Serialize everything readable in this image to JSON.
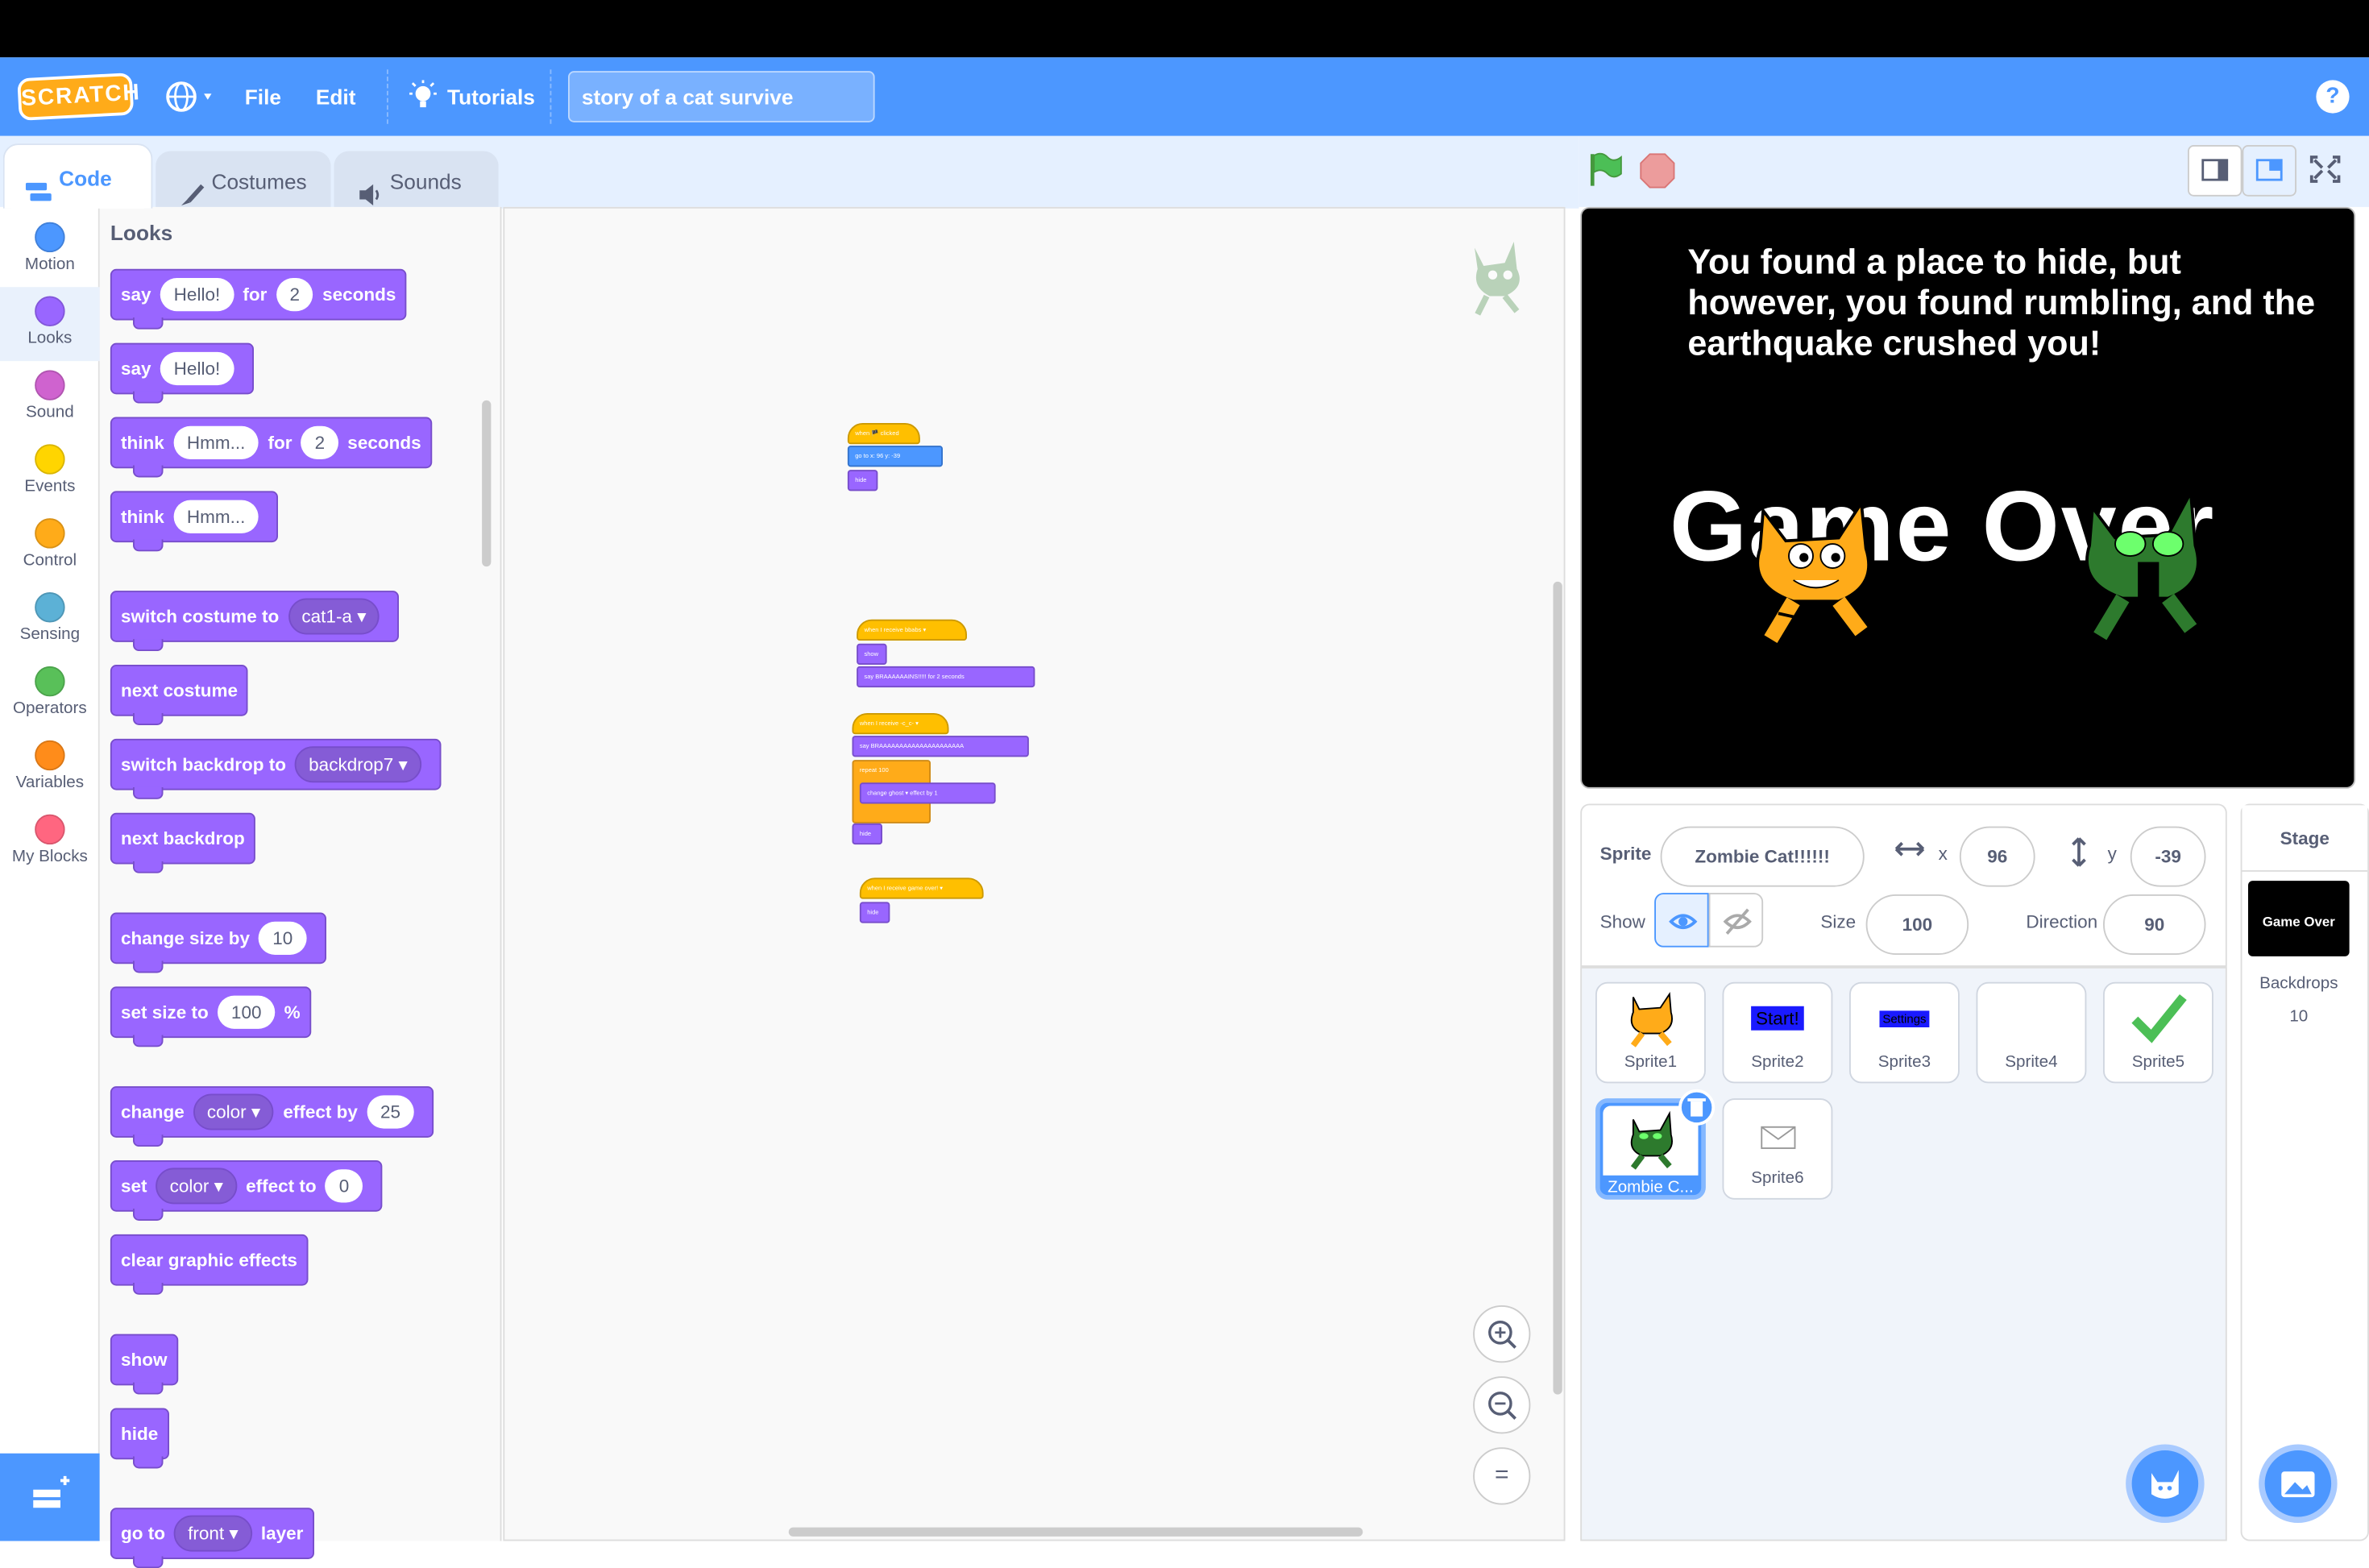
{
  "menu": {
    "file": "File",
    "edit": "Edit",
    "tutorials": "Tutorials",
    "logo": "SCRATCH",
    "project_title": "story of a cat survive",
    "help": "?"
  },
  "tabs": {
    "code": "Code",
    "costumes": "Costumes",
    "sounds": "Sounds"
  },
  "categories": [
    {
      "label": "Motion",
      "color": "#4c97ff"
    },
    {
      "label": "Looks",
      "color": "#9966ff"
    },
    {
      "label": "Sound",
      "color": "#cf63cf"
    },
    {
      "label": "Events",
      "color": "#ffd500"
    },
    {
      "label": "Control",
      "color": "#ffab19"
    },
    {
      "label": "Sensing",
      "color": "#5cb1d6"
    },
    {
      "label": "Operators",
      "color": "#59c059"
    },
    {
      "label": "Variables",
      "color": "#ff8c1a"
    },
    {
      "label": "My Blocks",
      "color": "#ff6680"
    }
  ],
  "palette": {
    "title": "Looks",
    "say_for": {
      "a": "say",
      "b": "Hello!",
      "c": "for",
      "d": "2",
      "e": "seconds"
    },
    "say": {
      "a": "say",
      "b": "Hello!"
    },
    "think_for": {
      "a": "think",
      "b": "Hmm...",
      "c": "for",
      "d": "2",
      "e": "seconds"
    },
    "think": {
      "a": "think",
      "b": "Hmm..."
    },
    "switch_costume": {
      "a": "switch costume to",
      "b": "cat1-a"
    },
    "next_costume": "next costume",
    "switch_backdrop": {
      "a": "switch backdrop to",
      "b": "backdrop7"
    },
    "next_backdrop": "next backdrop",
    "change_size": {
      "a": "change size by",
      "b": "10"
    },
    "set_size": {
      "a": "set size to",
      "b": "100",
      "c": "%"
    },
    "change_effect": {
      "a": "change",
      "b": "color",
      "c": "effect by",
      "d": "25"
    },
    "set_effect": {
      "a": "set",
      "b": "color",
      "c": "effect to",
      "d": "0"
    },
    "clear_effects": "clear graphic effects",
    "show": "show",
    "hide": "hide",
    "go_to_layer": {
      "a": "go to",
      "b": "front",
      "c": "layer"
    }
  },
  "scripts": {
    "s1": {
      "hat": "when 🏴 clicked",
      "goto": "go to x: 96 y: -39",
      "hide": "hide"
    },
    "s2": {
      "hat": "when I receive bbabs ▾",
      "show": "show",
      "say": "say BRAAAAAAINS!!!!! for 2 seconds"
    },
    "s3": {
      "hat": "when I receive -c_c- ▾",
      "say": "say BRAAAAAAAAAAAAAAAAAAAAA",
      "repeat": "repeat 100",
      "change": "change ghost ▾ effect by 1",
      "hide": "hide"
    },
    "s4": {
      "hat": "when I receive game over! ▾",
      "hide": "hide"
    }
  },
  "zoom": {
    "in": "+",
    "out": "−",
    "reset": "="
  },
  "stage": {
    "message": "You found a place to hide, but however, you found rumbling, and the earthquake crushed you!",
    "game_over": "Game Over"
  },
  "sprite_info": {
    "sprite_label": "Sprite",
    "sprite_name": "Zombie Cat!!!!!!",
    "x_label": "x",
    "x": "96",
    "y_label": "y",
    "y": "-39",
    "show_label": "Show",
    "size_label": "Size",
    "size": "100",
    "direction_label": "Direction",
    "direction": "90"
  },
  "sprites": [
    {
      "name": "Sprite1"
    },
    {
      "name": "Sprite2",
      "thumb": "Start!"
    },
    {
      "name": "Sprite3",
      "thumb": "Settings"
    },
    {
      "name": "Sprite4"
    },
    {
      "name": "Sprite5"
    },
    {
      "name": "Zombie C..."
    },
    {
      "name": "Sprite6"
    }
  ],
  "stage_pane": {
    "title": "Stage",
    "thumb_text": "Game Over",
    "backdrops_label": "Backdrops",
    "backdrops_count": "10"
  }
}
